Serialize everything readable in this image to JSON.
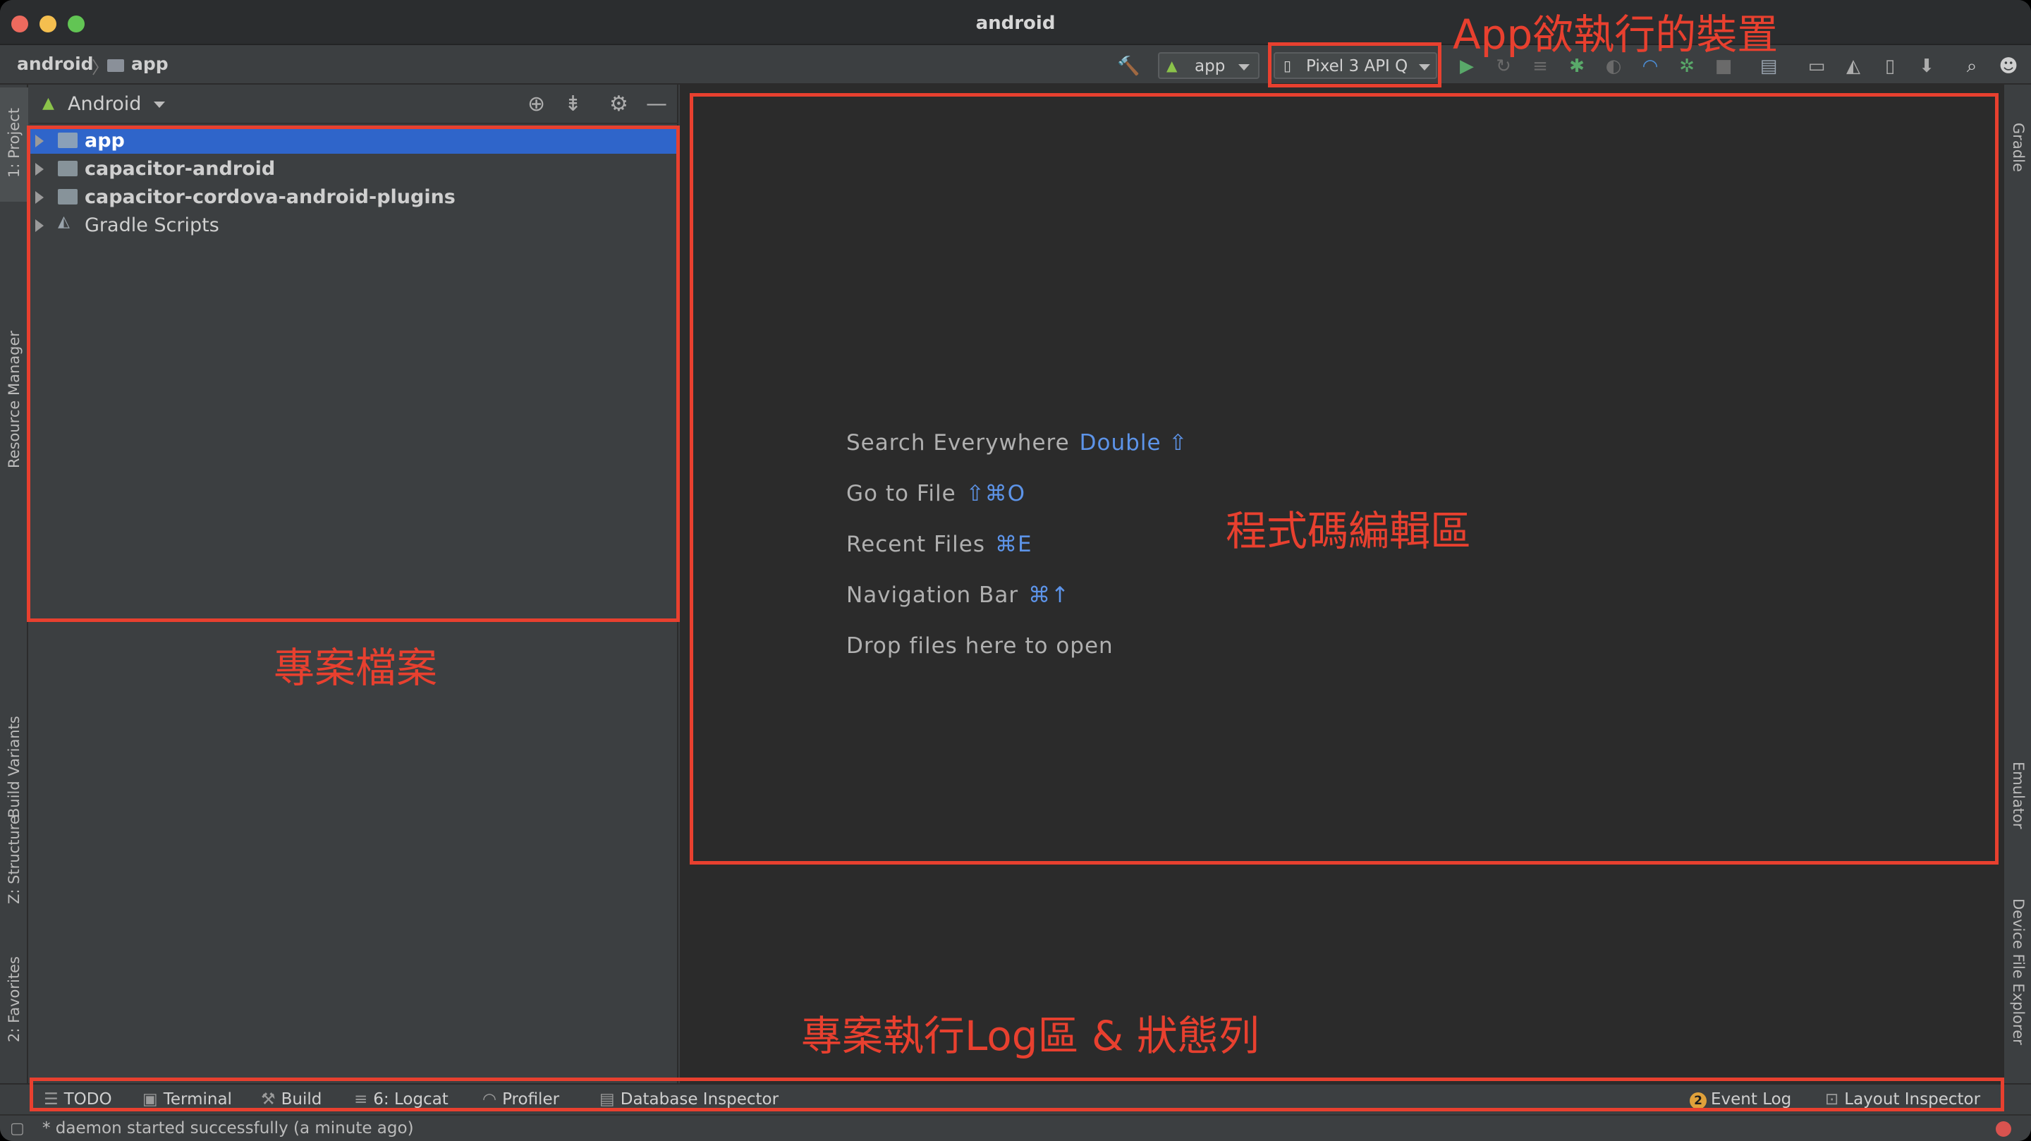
{
  "window": {
    "title": "android"
  },
  "navbar": {
    "breadcrumb": [
      "android",
      "app"
    ],
    "run_config": "app",
    "device": "Pixel 3 API Q"
  },
  "left_tabs": [
    "1: Project",
    "Resource Manager",
    "Build Variants",
    "Z: Structure",
    "2: Favorites"
  ],
  "right_tabs": [
    "Gradle",
    "Emulator",
    "Device File Explorer"
  ],
  "project_panel": {
    "view_selector": "Android",
    "tree": [
      "app",
      "capacitor-android",
      "capacitor-cordova-android-plugins",
      "Gradle Scripts"
    ]
  },
  "editor": {
    "hints": [
      {
        "label": "Search Everywhere",
        "key": "Double ⇧"
      },
      {
        "label": "Go to File",
        "key": "⇧⌘O"
      },
      {
        "label": "Recent Files",
        "key": "⌘E"
      },
      {
        "label": "Navigation Bar",
        "key": "⌘↑"
      },
      {
        "label": "Drop files here to open",
        "key": ""
      }
    ]
  },
  "bottom_tools": {
    "left": [
      "TODO",
      "Terminal",
      "Build",
      "6: Logcat",
      "Profiler",
      "Database Inspector"
    ],
    "event_log_count": "2",
    "event_log": "Event Log",
    "layout_inspector": "Layout Inspector"
  },
  "status": {
    "message": "* daemon started successfully (a minute ago)"
  },
  "annotations": {
    "device_label": "App欲執行的裝置",
    "project_files": "專案檔案",
    "code_editor": "程式碼編輯區",
    "log_status": "專案執行Log區 & 狀態列"
  },
  "colors": {
    "accent_selection": "#2f65ca",
    "annotation": "#e8402f",
    "run_green": "#59a869",
    "hint_key_blue": "#5d94e9"
  }
}
